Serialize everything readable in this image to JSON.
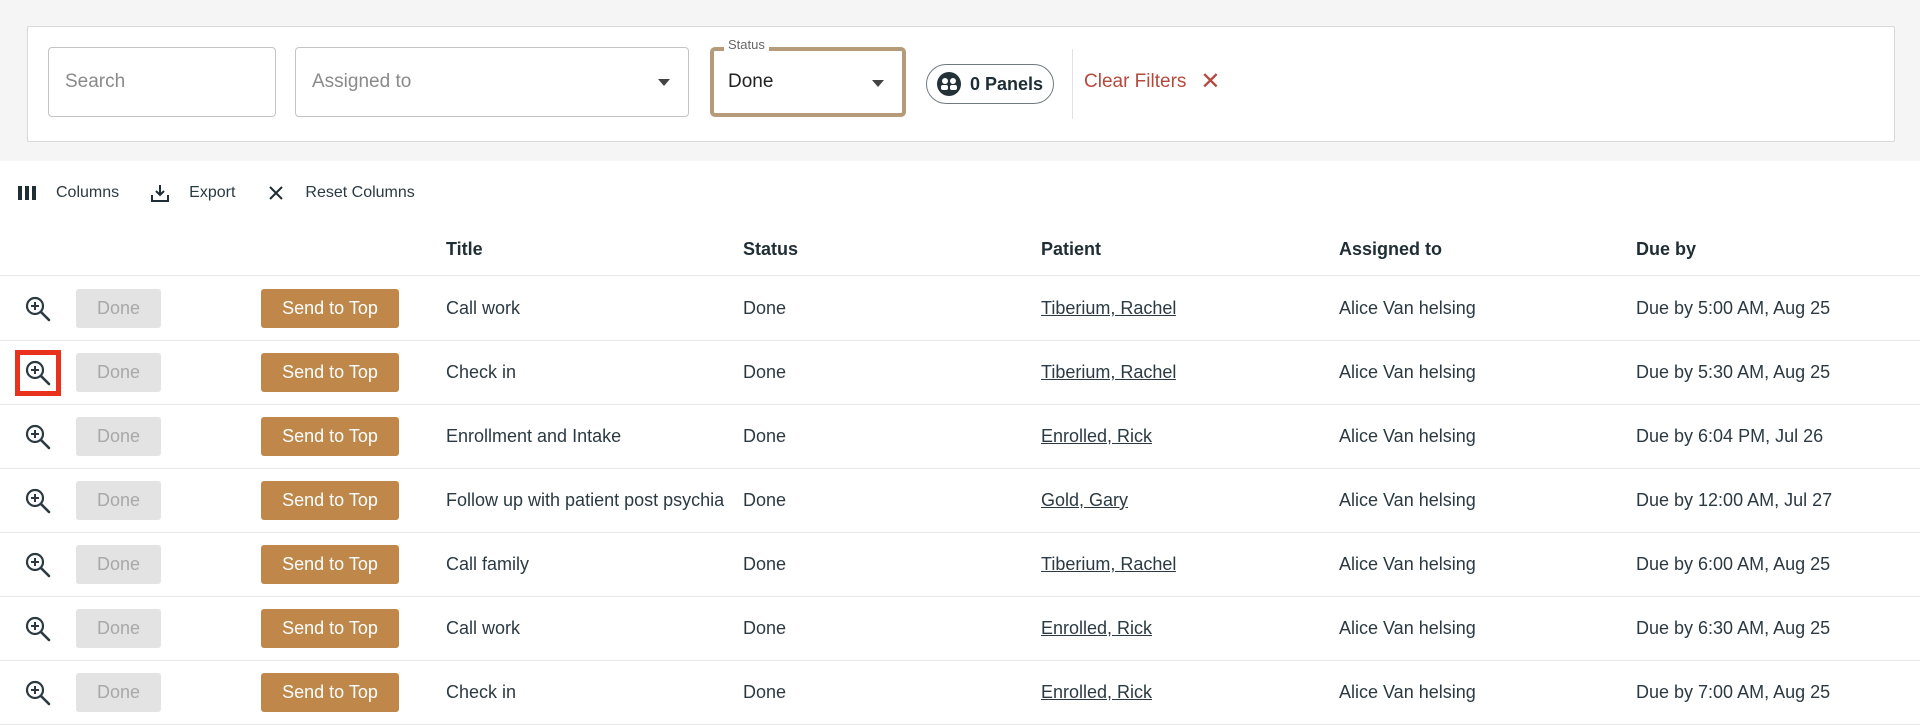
{
  "filters": {
    "search_placeholder": "Search",
    "assigned_placeholder": "Assigned to",
    "status_legend": "Status",
    "status_value": "Done",
    "panels_label": "0 Panels",
    "clear_label": "Clear Filters"
  },
  "toolbar": {
    "columns_label": "Columns",
    "export_label": "Export",
    "reset_label": "Reset Columns"
  },
  "table": {
    "headers": [
      "Title",
      "Status",
      "Patient",
      "Assigned to",
      "Due by"
    ],
    "done_label": "Done",
    "send_label": "Send to Top",
    "rows": [
      {
        "title": "Call work",
        "status": "Done",
        "patient": "Tiberium, Rachel",
        "assigned": "Alice Van helsing",
        "due": "Due by 5:00 AM, Aug 25"
      },
      {
        "title": "Check in",
        "status": "Done",
        "patient": "Tiberium, Rachel",
        "assigned": "Alice Van helsing",
        "due": "Due by 5:30 AM, Aug 25"
      },
      {
        "title": "Enrollment and Intake",
        "status": "Done",
        "patient": "Enrolled, Rick",
        "assigned": "Alice Van helsing",
        "due": "Due by 6:04 PM, Jul 26"
      },
      {
        "title": "Follow up with patient post psychia",
        "status": "Done",
        "patient": "Gold, Gary",
        "assigned": "Alice Van helsing",
        "due": "Due by 12:00 AM, Jul 27"
      },
      {
        "title": "Call family",
        "status": "Done",
        "patient": "Tiberium, Rachel",
        "assigned": "Alice Van helsing",
        "due": "Due by 6:00 AM, Aug 25"
      },
      {
        "title": "Call work",
        "status": "Done",
        "patient": "Enrolled, Rick",
        "assigned": "Alice Van helsing",
        "due": "Due by 6:30 AM, Aug 25"
      },
      {
        "title": "Check in",
        "status": "Done",
        "patient": "Enrolled, Rick",
        "assigned": "Alice Van helsing",
        "due": "Due by 7:00 AM, Aug 25"
      }
    ]
  },
  "colors": {
    "accent_button": "#c0874a",
    "clear_filters": "#b4493e",
    "status_border": "#b59b7a",
    "highlight": "#e8321e"
  },
  "icons": {
    "columns": "columns-icon",
    "export": "download-icon",
    "reset": "close-icon",
    "clear": "close-icon",
    "panels": "people-icon",
    "row_action": "zoom-in-icon"
  }
}
